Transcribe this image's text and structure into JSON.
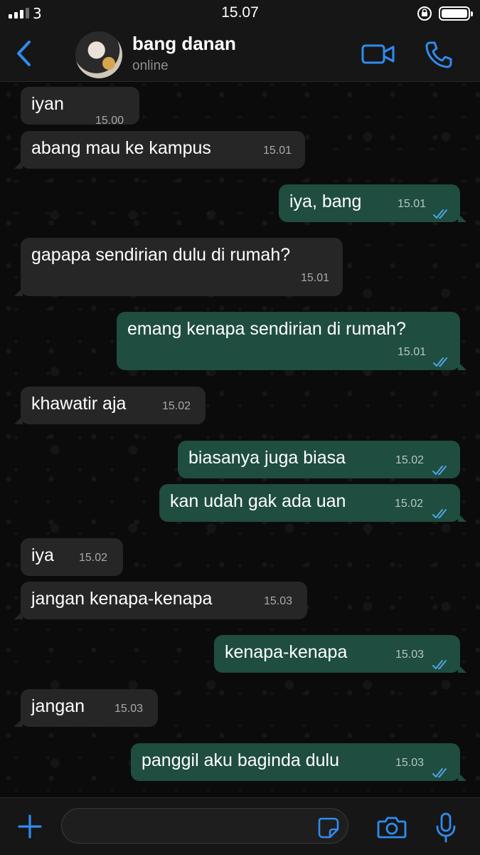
{
  "status_bar": {
    "carrier": "3",
    "time": "15.07"
  },
  "header": {
    "name": "bang danan",
    "status": "online",
    "icons": [
      "back-chevron-icon",
      "video-call-icon",
      "phone-call-icon"
    ]
  },
  "messages": [
    {
      "dir": "in",
      "text": "iyan",
      "time": "15.00"
    },
    {
      "dir": "in",
      "text": "abang mau ke kampus",
      "time": "15.01"
    },
    {
      "dir": "out",
      "text": "iya, bang",
      "time": "15.01"
    },
    {
      "dir": "in",
      "text": "gapapa sendirian dulu di rumah?",
      "time": "15.01"
    },
    {
      "dir": "out",
      "text": "emang kenapa sendirian di rumah?",
      "time": "15.01"
    },
    {
      "dir": "in",
      "text": "khawatir aja",
      "time": "15.02"
    },
    {
      "dir": "out",
      "text": "biasanya juga biasa",
      "time": "15.02"
    },
    {
      "dir": "out",
      "text": "kan udah gak ada uan",
      "time": "15.02"
    },
    {
      "dir": "in",
      "text": "iya",
      "time": "15.02"
    },
    {
      "dir": "in",
      "text": "jangan kenapa-kenapa",
      "time": "15.03"
    },
    {
      "dir": "out",
      "text": "kenapa-kenapa",
      "time": "15.03"
    },
    {
      "dir": "in",
      "text": "jangan",
      "time": "15.03"
    },
    {
      "dir": "out",
      "text": "panggil aku baginda dulu",
      "time": "15.03"
    }
  ],
  "input_bar": {
    "placeholder": "",
    "icons": [
      "plus-icon",
      "sticker-icon",
      "camera-icon",
      "microphone-icon"
    ]
  },
  "colors": {
    "accent": "#2f8cf0",
    "incoming_bubble": "#262626",
    "outgoing_bubble": "#1f4d3f",
    "read_ticks": "#4fa3e8"
  }
}
